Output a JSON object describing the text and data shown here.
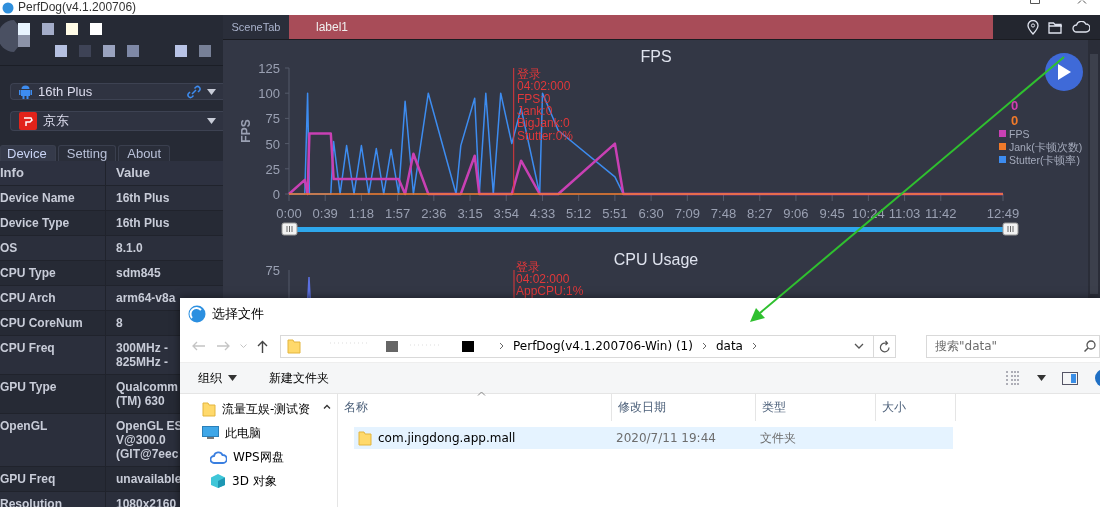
{
  "window": {
    "title": "PerfDog(v4.1.200706)"
  },
  "sidebar": {
    "device_select": {
      "value": "16th Plus"
    },
    "app_select": {
      "value": "京东"
    },
    "tabs": [
      {
        "label": "Device",
        "selected": true
      },
      {
        "label": "Setting",
        "selected": false
      },
      {
        "label": "About",
        "selected": false
      }
    ],
    "table": {
      "columns": [
        "Info",
        "Value"
      ],
      "rows": [
        {
          "info": "Device Name",
          "value": [
            "16th Plus"
          ]
        },
        {
          "info": "Device Type",
          "value": [
            "16th Plus"
          ]
        },
        {
          "info": "OS",
          "value": [
            "8.1.0"
          ]
        },
        {
          "info": "CPU Type",
          "value": [
            "sdm845"
          ]
        },
        {
          "info": "CPU Arch",
          "value": [
            "arm64-v8a"
          ]
        },
        {
          "info": "CPU CoreNum",
          "value": [
            "8"
          ]
        },
        {
          "info": "CPU Freq",
          "value": [
            "300MHz -",
            "825MHz -"
          ]
        },
        {
          "info": "GPU Type",
          "value": [
            "Qualcomm",
            "(TM) 630"
          ]
        },
        {
          "info": "OpenGL",
          "value": [
            "OpenGL ES",
            "V@300.0",
            "(GIT@7eec"
          ]
        },
        {
          "info": "GPU Freq",
          "value": [
            "unavailable"
          ]
        },
        {
          "info": "Resolution",
          "value": [
            "1080x2160"
          ]
        }
      ]
    }
  },
  "scene_tab": {
    "label": "SceneTab"
  },
  "label_bar": {
    "text": "label1"
  },
  "fps_chart": {
    "marker_lines": [
      "登录",
      "04:02:000",
      "FPS:0",
      "Jank:0",
      "BigJank:0",
      "Stutter:0%"
    ],
    "readings": [
      {
        "text": "0",
        "color": "#d23fb0"
      },
      {
        "text": "0",
        "color": "#f07a2a"
      }
    ],
    "chart_data": {
      "type": "line",
      "title": "FPS",
      "ylabel": "FPS",
      "x": [
        0,
        17,
        20,
        22,
        45,
        48,
        55,
        62,
        70,
        78,
        86,
        94,
        102,
        110,
        118,
        125,
        134,
        150,
        180,
        185,
        200,
        205,
        212,
        220,
        228,
        240,
        250,
        270,
        273,
        290,
        351,
        360,
        769
      ],
      "series": [
        {
          "name": "FPS",
          "color": "#c940b4",
          "values": [
            0,
            14,
            0,
            60,
            60,
            15,
            15,
            15,
            15,
            15,
            15,
            15,
            15,
            15,
            15,
            0,
            40,
            0,
            0,
            0,
            38,
            0,
            0,
            0,
            0,
            0,
            33,
            0,
            0,
            0,
            50,
            0,
            0
          ]
        },
        {
          "name": "Jank(卡顿次数)",
          "color": "#f07a2a",
          "values": [
            0,
            0,
            0,
            0,
            0,
            0,
            0,
            0,
            0,
            0,
            0,
            0,
            0,
            0,
            0,
            0,
            0,
            0,
            0,
            0,
            0,
            0,
            0,
            0,
            0,
            0,
            0,
            0,
            0,
            0,
            0,
            0,
            0
          ]
        },
        {
          "name": "Stutter(卡顿率)",
          "color": "#3d8cf0",
          "values": [
            0,
            0,
            100,
            0,
            0,
            52,
            0,
            48,
            0,
            48,
            0,
            45,
            0,
            44,
            0,
            92,
            0,
            100,
            0,
            48,
            95,
            0,
            100,
            0,
            100,
            50,
            85,
            0,
            100,
            63,
            17,
            0,
            0
          ]
        }
      ],
      "xlim": [
        0,
        769
      ],
      "ylim": [
        0,
        125
      ],
      "xticks": [
        {
          "value": 0,
          "label": "0:00"
        },
        {
          "value": 39,
          "label": "0:39"
        },
        {
          "value": 78,
          "label": "1:18"
        },
        {
          "value": 117,
          "label": "1:57"
        },
        {
          "value": 156,
          "label": "2:36"
        },
        {
          "value": 195,
          "label": "3:15"
        },
        {
          "value": 234,
          "label": "3:54"
        },
        {
          "value": 273,
          "label": "4:33"
        },
        {
          "value": 312,
          "label": "5:12"
        },
        {
          "value": 351,
          "label": "5:51"
        },
        {
          "value": 390,
          "label": "6:30"
        },
        {
          "value": 429,
          "label": "7:09"
        },
        {
          "value": 468,
          "label": "7:48"
        },
        {
          "value": 507,
          "label": "8:27"
        },
        {
          "value": 546,
          "label": "9:06"
        },
        {
          "value": 585,
          "label": "9:45"
        },
        {
          "value": 624,
          "label": "10:24"
        },
        {
          "value": 663,
          "label": "11:03"
        },
        {
          "value": 702,
          "label": "11:42"
        },
        {
          "value": 769,
          "label": "12:49"
        }
      ],
      "yticks": [
        0,
        25,
        50,
        75,
        100,
        125
      ],
      "ref_lines": [
        {
          "axis": "x",
          "value": 242,
          "color": "#e0383a"
        }
      ],
      "legend": true
    }
  },
  "cpu_chart": {
    "title": "CPU Usage",
    "y_tick": "75",
    "marker_lines": [
      "登录",
      "04:02:000",
      "AppCPU:1%"
    ]
  },
  "file_dialog": {
    "title": "选择文件",
    "breadcrumbs": [
      "PerfDog(v4.1.200706-Win) (1)",
      "data"
    ],
    "search": {
      "placeholder": "搜索\"data\""
    },
    "toolbar": [
      {
        "label": "组织",
        "kind": "menu"
      },
      {
        "label": "新建文件夹",
        "kind": "button"
      }
    ],
    "nav": [
      {
        "label": "流量互娱-测试资",
        "kind": "folder"
      },
      {
        "label": "此电脑",
        "kind": "computer",
        "children": [
          {
            "label": "WPS网盘",
            "kind": "cloud"
          },
          {
            "label": "3D 对象",
            "kind": "cube"
          }
        ]
      }
    ],
    "columns": [
      "名称",
      "修改日期",
      "类型",
      "大小"
    ],
    "rows": [
      {
        "name": "com.jingdong.app.mall",
        "modified": "2020/7/11 19:44",
        "type": "文件夹",
        "selected": true
      }
    ]
  }
}
